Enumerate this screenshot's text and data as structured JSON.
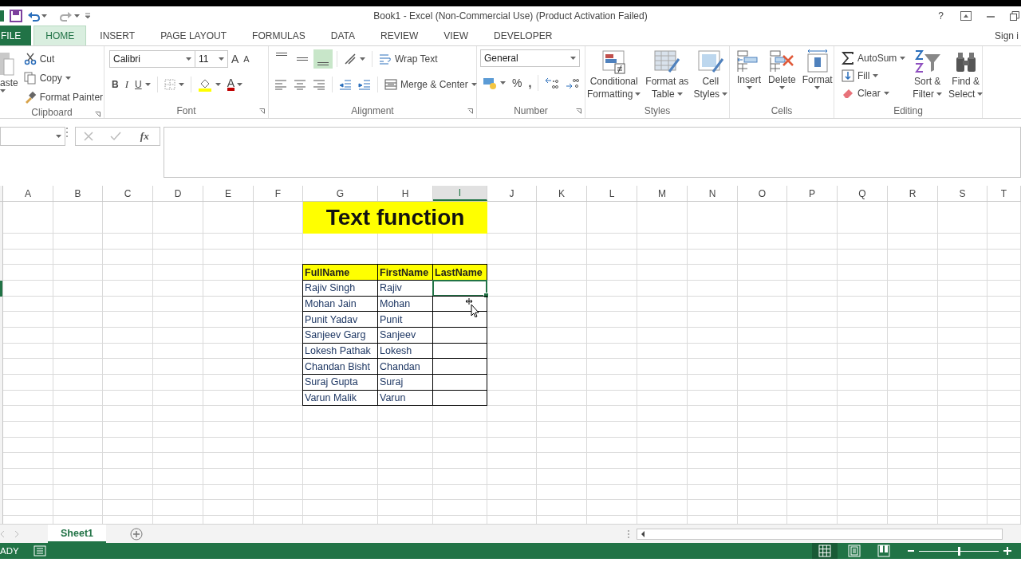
{
  "title_bar": {
    "title": "Book1 - Excel (Non-Commercial Use) (Product Activation Failed)",
    "help": "?"
  },
  "tabs": [
    {
      "label": "FILE",
      "kind": "file",
      "selected": false
    },
    {
      "label": "HOME",
      "kind": "tab",
      "selected": true
    },
    {
      "label": "INSERT",
      "kind": "tab",
      "selected": false
    },
    {
      "label": "PAGE LAYOUT",
      "kind": "tab",
      "selected": false
    },
    {
      "label": "FORMULAS",
      "kind": "tab",
      "selected": false
    },
    {
      "label": "DATA",
      "kind": "tab",
      "selected": false
    },
    {
      "label": "REVIEW",
      "kind": "tab",
      "selected": false
    },
    {
      "label": "VIEW",
      "kind": "tab",
      "selected": false
    },
    {
      "label": "DEVELOPER",
      "kind": "tab",
      "selected": false
    }
  ],
  "account": {
    "label": "Sign i"
  },
  "ribbon": {
    "groups": [
      {
        "kind": "clipboard",
        "name": "Clipboard",
        "paste": "aste",
        "cut": "Cut",
        "copy": "Copy",
        "format_painter": "Format Painter"
      },
      {
        "kind": "font",
        "name": "Font",
        "font_name": "Calibri",
        "font_size": "11",
        "grow": "A",
        "shrink": "A",
        "bold": "B",
        "italic": "I",
        "underline": "U",
        "font_color": "A"
      },
      {
        "kind": "alignment",
        "name": "Alignment",
        "vertical_align": [
          {
            "selected": false
          },
          {
            "selected": false
          },
          {
            "selected": true
          }
        ],
        "wrap_text": "Wrap Text",
        "merge_center": "Merge & Center"
      },
      {
        "kind": "number",
        "name": "Number",
        "format": "General",
        "percent": "%",
        "comma": ","
      },
      {
        "kind": "styles",
        "name": "Styles",
        "buttons": [
          {
            "line1": "Conditional",
            "line2": "Formatting"
          },
          {
            "line1": "Format as",
            "line2": "Table"
          },
          {
            "line1": "Cell",
            "line2": "Styles"
          }
        ]
      },
      {
        "kind": "cells",
        "name": "Cells",
        "buttons": [
          "Insert",
          "Delete",
          "Format"
        ]
      },
      {
        "kind": "editing",
        "name": "Editing",
        "autosum": "AutoSum",
        "fill": "Fill",
        "clear": "Clear",
        "buttons": [
          {
            "line1": "Sort &",
            "line2": "Filter"
          },
          {
            "line1": "Find &",
            "line2": "Select"
          }
        ]
      }
    ]
  },
  "formula_bar": {
    "fx": "fx"
  },
  "sheet": {
    "columns": [
      {
        "label": "A",
        "selected": false
      },
      {
        "label": "B",
        "selected": false
      },
      {
        "label": "C",
        "selected": false
      },
      {
        "label": "D",
        "selected": false
      },
      {
        "label": "E",
        "selected": false
      },
      {
        "label": "F",
        "selected": false
      },
      {
        "label": "G",
        "selected": false
      },
      {
        "label": "H",
        "selected": false
      },
      {
        "label": "I",
        "selected": true
      },
      {
        "label": "J",
        "selected": false
      },
      {
        "label": "K",
        "selected": false
      },
      {
        "label": "L",
        "selected": false
      },
      {
        "label": "M",
        "selected": false
      },
      {
        "label": "N",
        "selected": false
      },
      {
        "label": "O",
        "selected": false
      },
      {
        "label": "P",
        "selected": false
      },
      {
        "label": "Q",
        "selected": false
      },
      {
        "label": "R",
        "selected": false
      },
      {
        "label": "S",
        "selected": false
      },
      {
        "label": "T",
        "selected": false
      }
    ],
    "title": "Text function",
    "table": {
      "headers": [
        "FullName",
        "FirstName",
        "LastName"
      ],
      "rows": [
        {
          "full_name": "Rajiv Singh",
          "first_name": "Rajiv",
          "active": true
        },
        {
          "full_name": "Mohan Jain",
          "first_name": "Mohan",
          "active": false
        },
        {
          "full_name": "Punit Yadav",
          "first_name": "Punit",
          "active": false
        },
        {
          "full_name": "Sanjeev Garg",
          "first_name": "Sanjeev",
          "active": false
        },
        {
          "full_name": "Lokesh Pathak",
          "first_name": "Lokesh",
          "active": false
        },
        {
          "full_name": "Chandan Bisht",
          "first_name": "Chandan",
          "active": false
        },
        {
          "full_name": "Suraj Gupta",
          "first_name": "Suraj",
          "active": false
        },
        {
          "full_name": "Varun Malik",
          "first_name": "Varun",
          "active": false
        }
      ]
    }
  },
  "sheet_tabs": [
    {
      "label": "Sheet1",
      "selected": true
    }
  ],
  "status_bar": {
    "mode": "ADY",
    "views": [
      {
        "selected": true
      },
      {
        "selected": false
      },
      {
        "selected": false
      }
    ],
    "zoom": {
      "level": 0.5
    }
  }
}
